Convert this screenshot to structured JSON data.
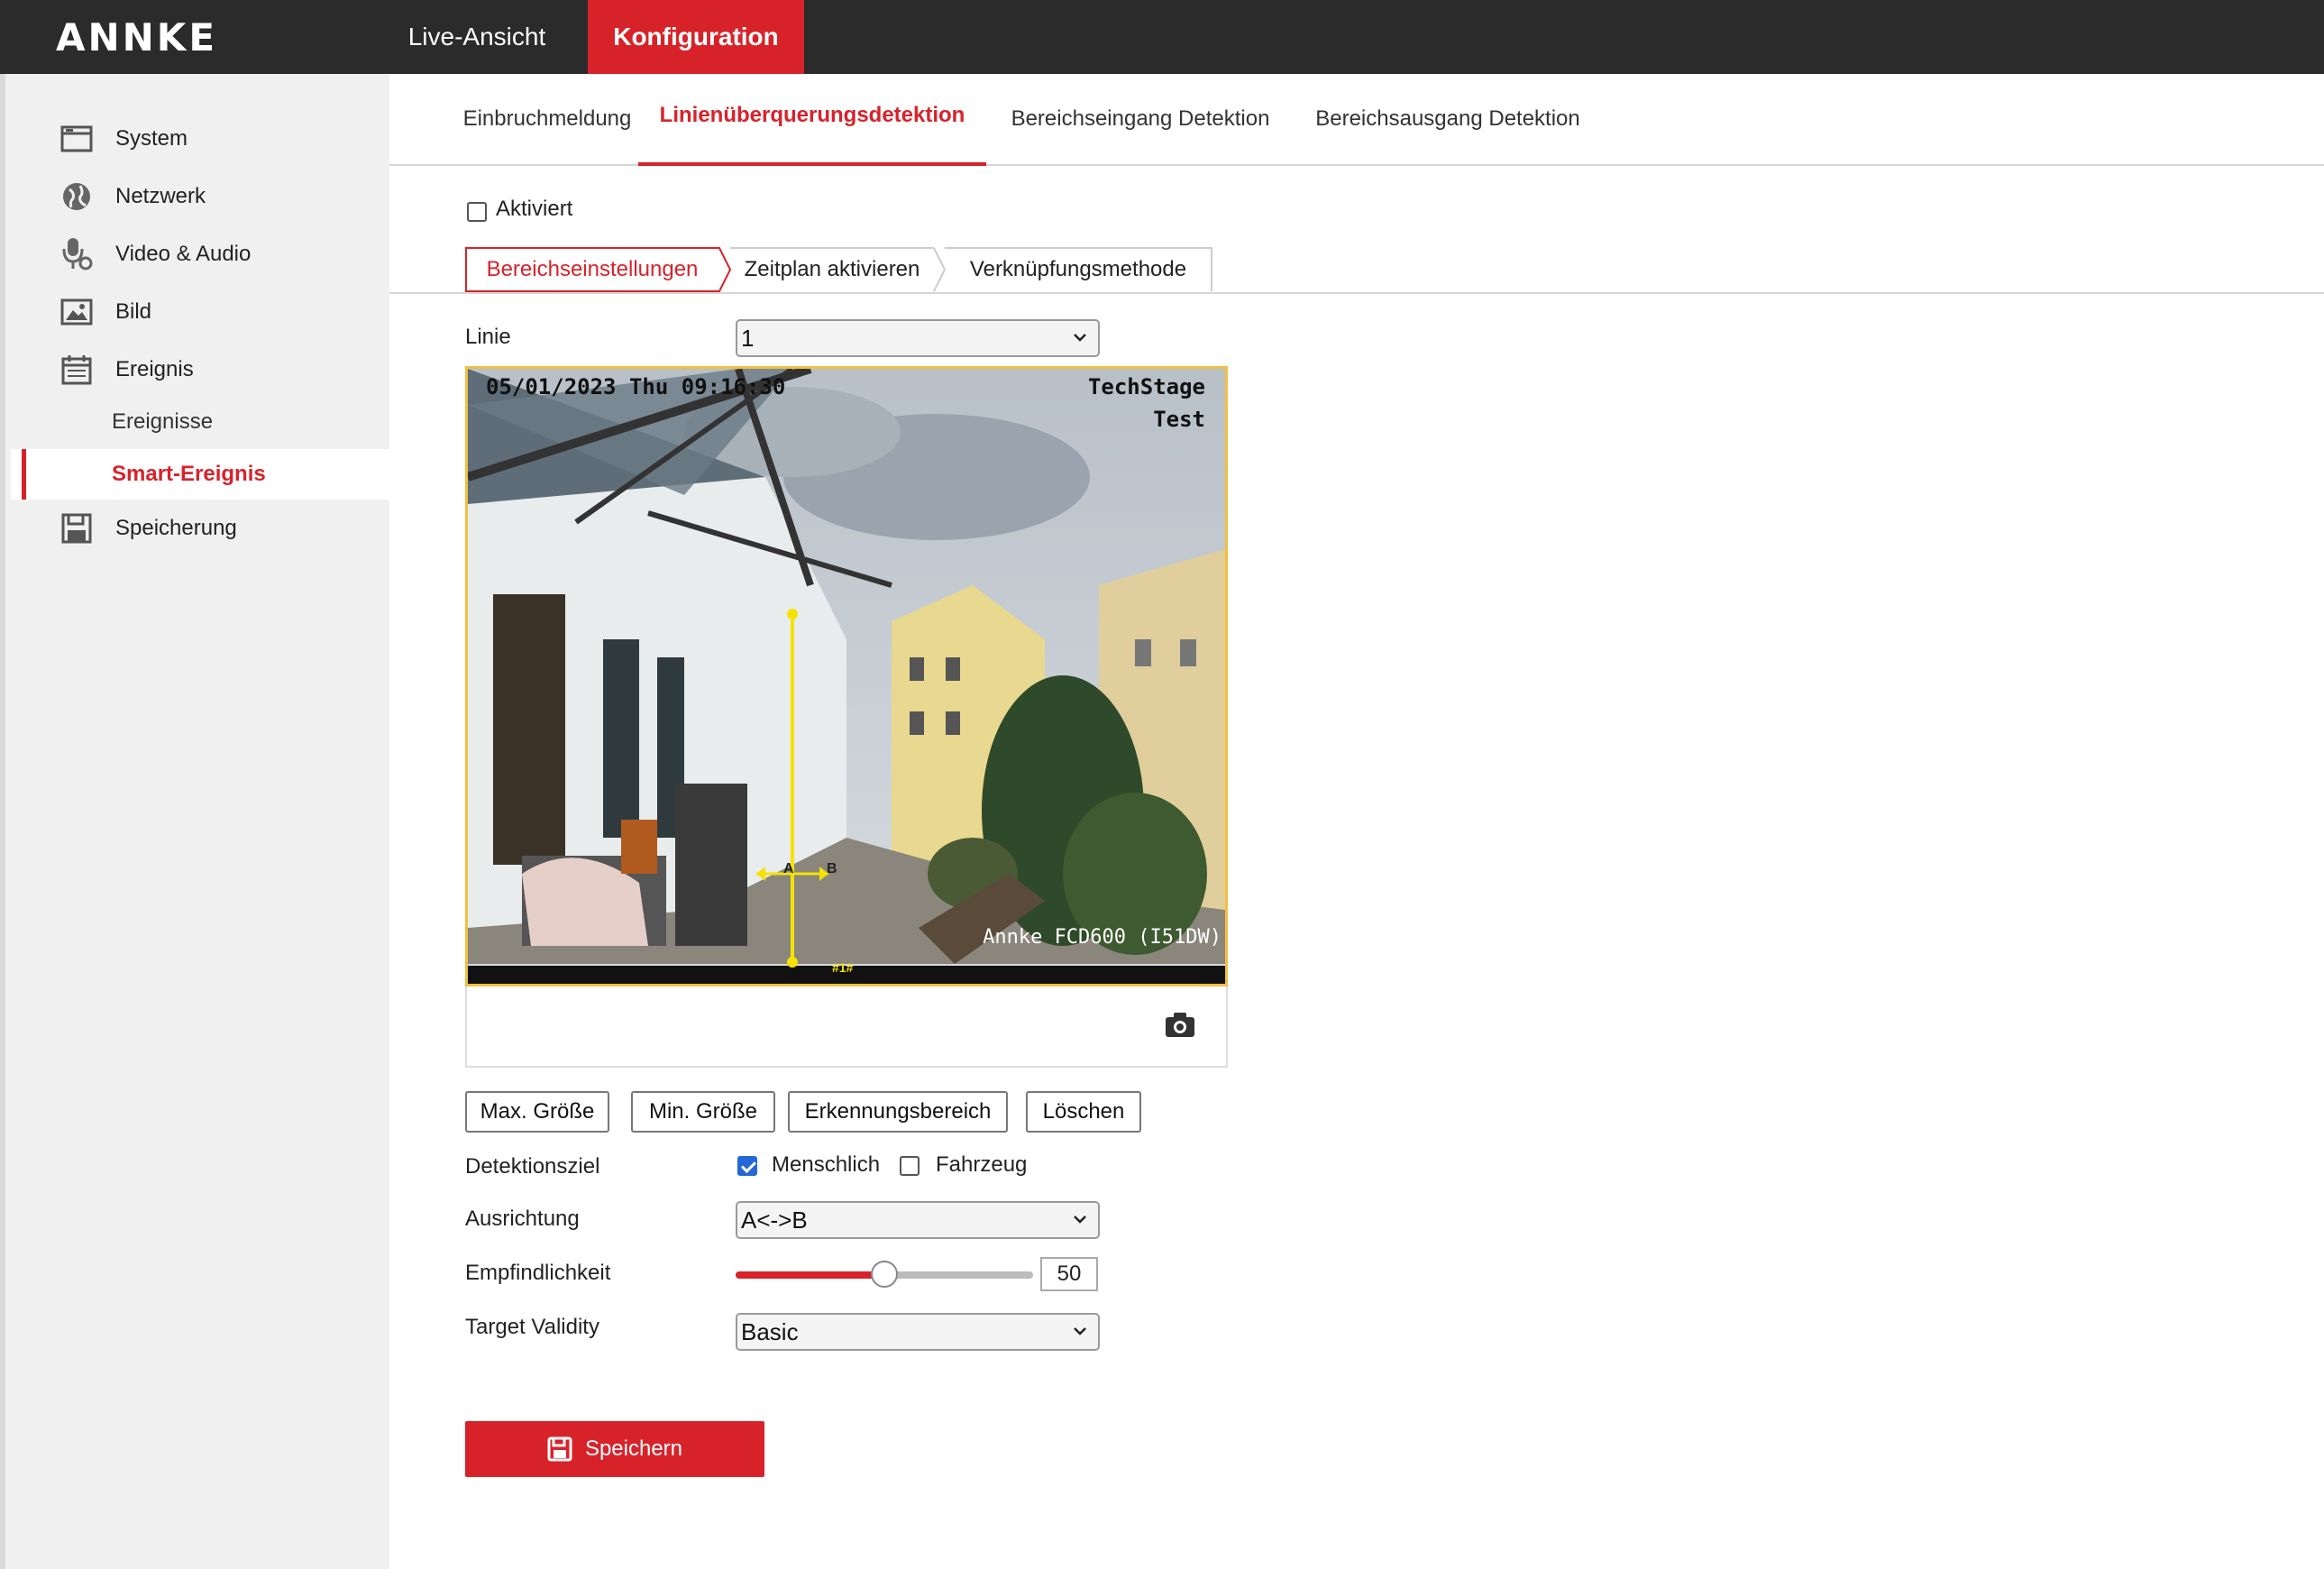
{
  "header": {
    "logo": "ANNKE",
    "nav": [
      {
        "label": "Live-Ansicht"
      },
      {
        "label": "Konfiguration"
      }
    ]
  },
  "sidebar": {
    "items": [
      {
        "label": "System",
        "icon": "monitor-icon"
      },
      {
        "label": "Netzwerk",
        "icon": "globe-icon"
      },
      {
        "label": "Video & Audio",
        "icon": "microphone-camera-icon"
      },
      {
        "label": "Bild",
        "icon": "image-icon"
      },
      {
        "label": "Ereignis",
        "icon": "calendar-icon"
      },
      {
        "label": "Speicherung",
        "icon": "floppy-disk-icon"
      }
    ],
    "subitems": [
      {
        "label": "Ereignisse"
      },
      {
        "label": "Smart-Ereignis"
      }
    ]
  },
  "tabs": [
    {
      "label": "Einbruchmeldung"
    },
    {
      "label": "Linienüberquerungsdetektion"
    },
    {
      "label": "Bereichseingang Detektion"
    },
    {
      "label": "Bereichsausgang Detektion"
    }
  ],
  "enable": {
    "label": "Aktiviert",
    "checked": false
  },
  "steps": [
    {
      "label": "Bereichseinstellungen"
    },
    {
      "label": "Zeitplan aktivieren"
    },
    {
      "label": "Verknüpfungsmethode"
    }
  ],
  "form": {
    "line_label": "Linie",
    "line_value": "1",
    "detection_target_label": "Detektionsziel",
    "human_label": "Menschlich",
    "human_checked": true,
    "vehicle_label": "Fahrzeug",
    "vehicle_checked": false,
    "direction_label": "Ausrichtung",
    "direction_value": "A<->B",
    "sensitivity_label": "Empfindlichkeit",
    "sensitivity_value": "50",
    "validity_label": "Target Validity",
    "validity_value": "Basic"
  },
  "video": {
    "osd_datetime": "05/01/2023 Thu 09:16:30",
    "osd_name_line1": "TechStage",
    "osd_name_line2": "Test",
    "osd_camera": "Annke FCD600 (I51DW)",
    "line_label_a": "A",
    "line_label_b": "B",
    "line_id": "#1#"
  },
  "buttons": {
    "max_size": "Max. Größe",
    "min_size": "Min. Größe",
    "detection_area": "Erkennungsbereich",
    "delete": "Löschen",
    "save": "Speichern"
  },
  "colors": {
    "accent": "#d8222a",
    "topbar": "#2b2b2b",
    "sidebar": "#f0f0f0",
    "checkbox_checked": "#2468d8"
  }
}
